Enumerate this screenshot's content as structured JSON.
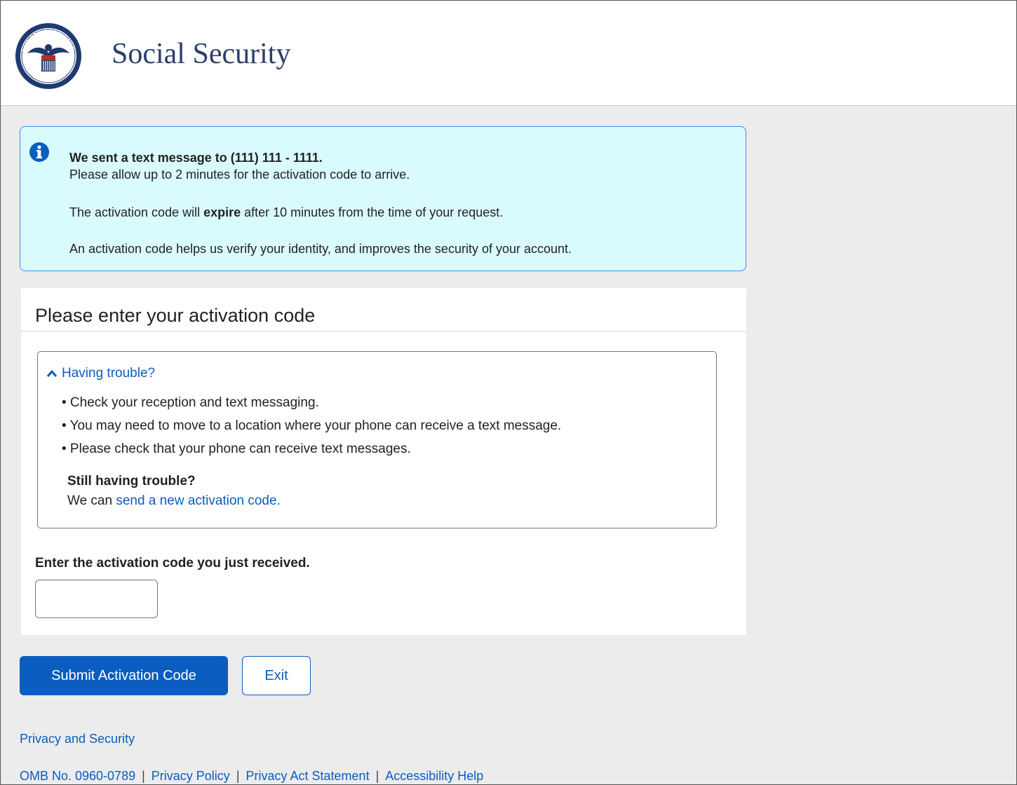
{
  "header": {
    "title": "Social Security",
    "logo_icon": "ssa-seal-icon"
  },
  "alert": {
    "icon": "info-icon",
    "line_bold": "We sent a text message to (111) 111 - 1111.",
    "line_2": "Please allow up to 2 minutes for the activation code to arrive.",
    "line_3_before": "The activation code will ",
    "line_3_bold": "expire",
    "line_3_after": " after 10 minutes from the time of your request.",
    "line_4": "An activation code helps us verify your identity, and improves the security of your account."
  },
  "form": {
    "title": "Please enter your activation code",
    "trouble": {
      "toggle_label": "Having trouble?",
      "bullets": [
        "• Check your reception and text messaging.",
        "• You may need to move to a location where your phone can receive a text message.",
        "• Please check that your phone can receive text messages."
      ],
      "still_title": "Still having trouble?",
      "still_prefix": "We can ",
      "still_link": "send a new activation code."
    },
    "code_label": "Enter the activation code you just received.",
    "code_value": ""
  },
  "buttons": {
    "submit": "Submit Activation Code",
    "exit": "Exit"
  },
  "footer": {
    "privacy_security": "Privacy and Security",
    "omb": "OMB No. 0960-0789",
    "privacy_policy": "Privacy Policy",
    "privacy_act": "Privacy Act Statement",
    "accessibility": "Accessibility Help",
    "separator": "|"
  },
  "colors": {
    "link": "#0b5dbf",
    "alert_bg": "#dafbfd",
    "alert_border": "#3d8ee0",
    "title": "#2c3e6b"
  }
}
